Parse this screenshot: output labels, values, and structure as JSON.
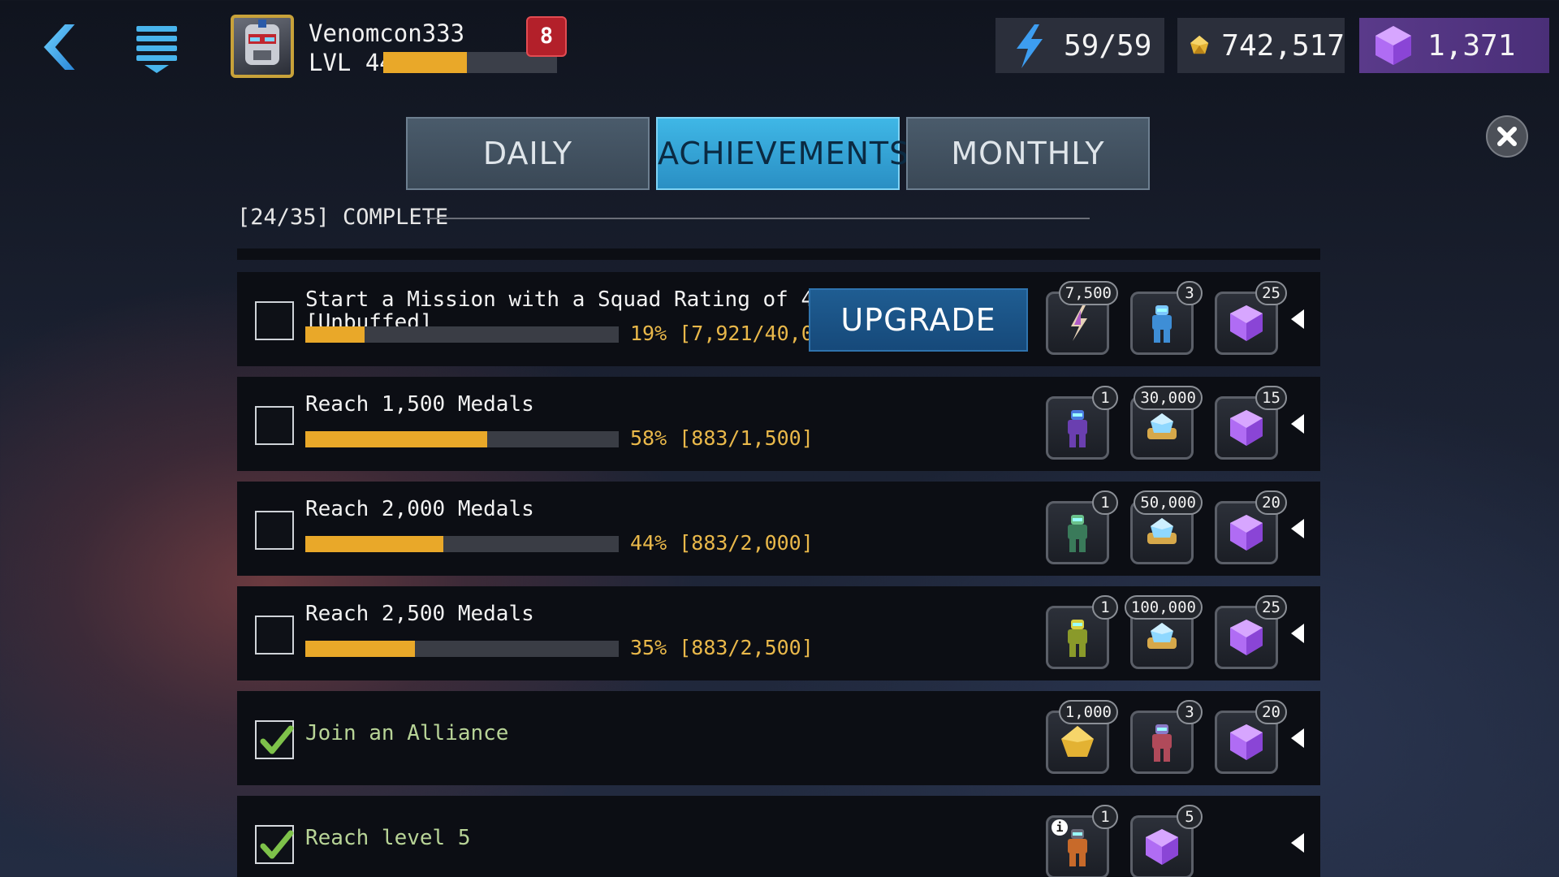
{
  "player": {
    "name": "Venomcon333",
    "level": "LVL 44",
    "xp_fill": 0.48,
    "notifications": "8"
  },
  "resources": {
    "energy": "59/59",
    "gold": "742,517",
    "gems": "1,371"
  },
  "tabs": [
    {
      "label": "DAILY"
    },
    {
      "label": "ACHIEVEMENTS",
      "active": true
    },
    {
      "label": "MONTHLY"
    }
  ],
  "progress_summary": "[24/35] COMPLETE",
  "tasks": [
    {
      "title": "Start a Mission with a Squad Rating of 40,000",
      "title2": "[Unbuffed]",
      "percent": "19%",
      "count": "[7,921/40,000]",
      "fill": 0.19,
      "completed": false,
      "action": "UPGRADE",
      "rewards": [
        {
          "icon": "shard-icon",
          "qty": "7,500"
        },
        {
          "icon": "robot-blue-icon",
          "qty": "3"
        },
        {
          "icon": "gem-icon",
          "qty": "25"
        }
      ]
    },
    {
      "title": "Reach 1,500 Medals",
      "percent": "58%",
      "count": "[883/1,500]",
      "fill": 0.58,
      "completed": false,
      "rewards": [
        {
          "icon": "robot-purple-icon",
          "qty": "1"
        },
        {
          "icon": "crystal-icon",
          "qty": "30,000"
        },
        {
          "icon": "gem-icon",
          "qty": "15"
        }
      ]
    },
    {
      "title": "Reach 2,000 Medals",
      "percent": "44%",
      "count": "[883/2,000]",
      "fill": 0.44,
      "completed": false,
      "rewards": [
        {
          "icon": "robot-green-icon",
          "qty": "1"
        },
        {
          "icon": "crystal-icon",
          "qty": "50,000"
        },
        {
          "icon": "gem-icon",
          "qty": "20"
        }
      ]
    },
    {
      "title": "Reach 2,500 Medals",
      "percent": "35%",
      "count": "[883/2,500]",
      "fill": 0.35,
      "completed": false,
      "rewards": [
        {
          "icon": "robot-yellow-icon",
          "qty": "1"
        },
        {
          "icon": "crystal-icon",
          "qty": "100,000"
        },
        {
          "icon": "gem-icon",
          "qty": "25"
        }
      ]
    },
    {
      "title": "Join an Alliance",
      "completed": true,
      "rewards": [
        {
          "icon": "gold-icon",
          "qty": "1,000"
        },
        {
          "icon": "robot-red-icon",
          "qty": "3"
        },
        {
          "icon": "gem-icon",
          "qty": "20"
        }
      ]
    },
    {
      "title": "Reach level 5",
      "completed": true,
      "rewards": [
        {
          "icon": "robot-orange-icon",
          "qty": "1"
        },
        {
          "icon": "gem-icon",
          "qty": "5"
        }
      ]
    }
  ],
  "colors": {
    "accent": "#3fb7e6",
    "progress": "#e9a829",
    "gem": "#a55cf0",
    "done_text": "#b8d497"
  }
}
